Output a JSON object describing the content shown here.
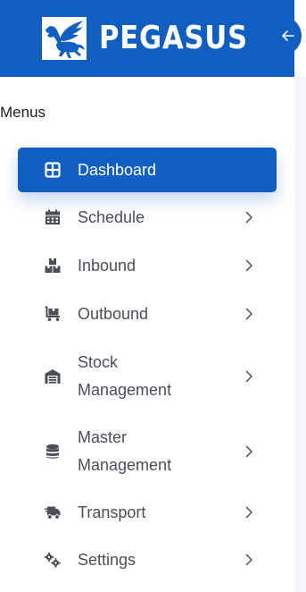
{
  "brand": {
    "name": "PEGASUS",
    "header_color": "#0f5fc2"
  },
  "collapse": {
    "icon": "arrow-left-icon"
  },
  "sidebar": {
    "section_title": "Menus",
    "items": [
      {
        "label_lines": [
          "Dashboard"
        ],
        "icon": "dashboard-grid-icon",
        "active": true,
        "has_submenu": false
      },
      {
        "label_lines": [
          "Schedule"
        ],
        "icon": "calendar-icon",
        "active": false,
        "has_submenu": true
      },
      {
        "label_lines": [
          "Inbound"
        ],
        "icon": "boxes-icon",
        "active": false,
        "has_submenu": true
      },
      {
        "label_lines": [
          "Outbound"
        ],
        "icon": "cart-flatbed-icon",
        "active": false,
        "has_submenu": true
      },
      {
        "label_lines": [
          "Stock",
          "Management"
        ],
        "icon": "warehouse-icon",
        "active": false,
        "has_submenu": true
      },
      {
        "label_lines": [
          "Master",
          "Management"
        ],
        "icon": "database-icon",
        "active": false,
        "has_submenu": true
      },
      {
        "label_lines": [
          "Transport"
        ],
        "icon": "truck-fast-icon",
        "active": false,
        "has_submenu": true
      },
      {
        "label_lines": [
          "Settings"
        ],
        "icon": "gears-icon",
        "active": false,
        "has_submenu": true
      }
    ]
  }
}
